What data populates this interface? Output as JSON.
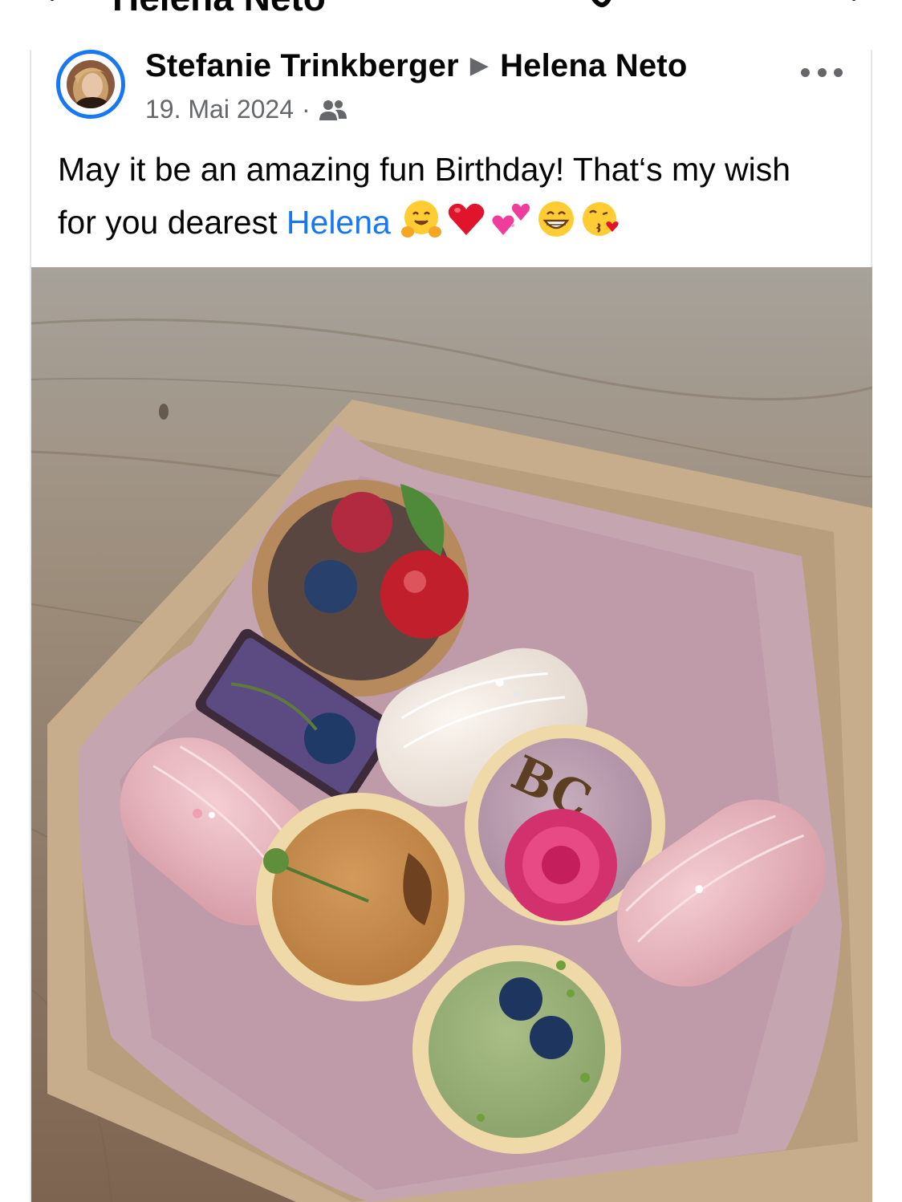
{
  "header": {
    "title": "Helena Neto"
  },
  "post": {
    "author": "Stefanie Trinkberger",
    "recipient": "Helena Neto",
    "date": "19. Mai 2024",
    "separator": "·",
    "audience_icon": "friends-icon",
    "text_before": "May it be an amazing fun Birthday! That‘s my wish for you dearest",
    "mention": "Helena",
    "emojis": [
      "hugging-face",
      "red-heart",
      "two-hearts",
      "grinning-face",
      "face-blowing-kiss"
    ]
  },
  "colors": {
    "link": "#1877f2",
    "secondary_text": "#65676b",
    "avatar_ring": "#1877f2"
  }
}
